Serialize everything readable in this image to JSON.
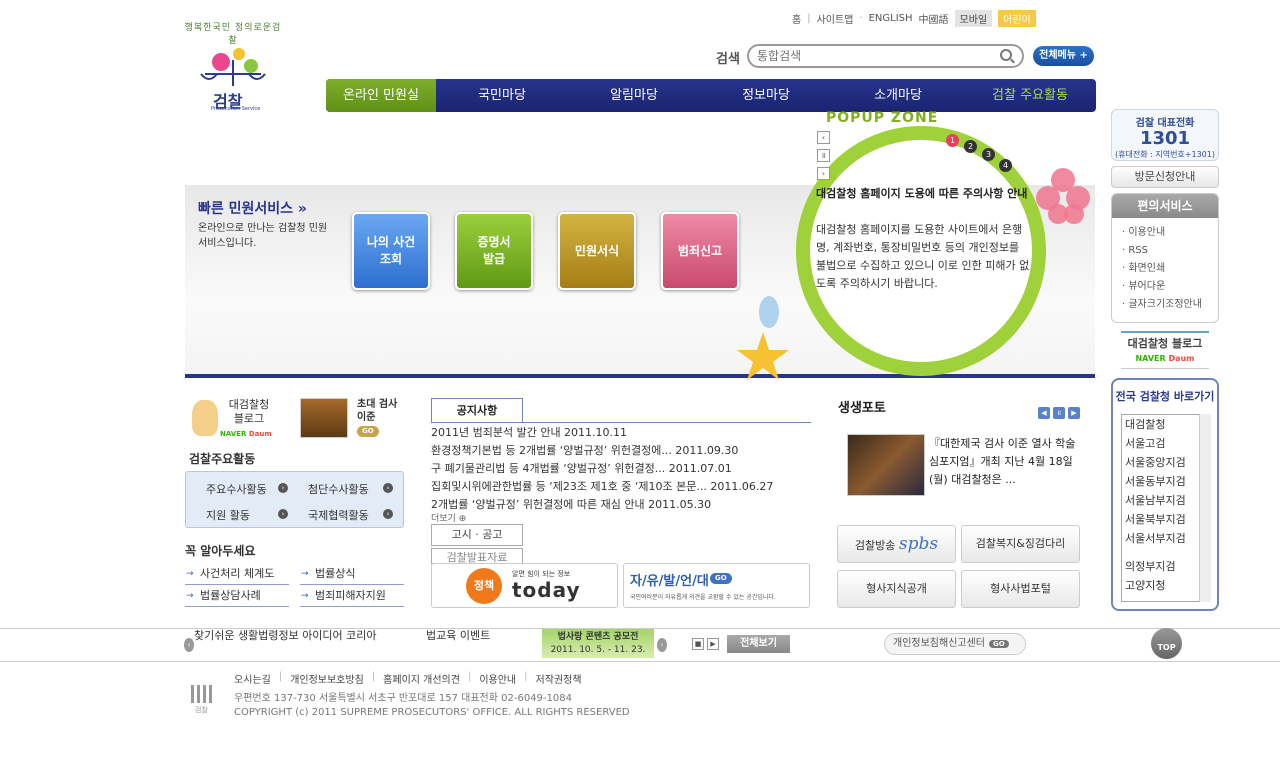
{
  "util": {
    "home": "홈",
    "sitemap": "사이트맵",
    "english": "ENGLISH",
    "chinese": "中國語",
    "mobile": "모바일",
    "kids": "어린이"
  },
  "logo": {
    "arc": "행복한국민 정의로운검찰",
    "name": "검찰",
    "sub": "Prosecution Service"
  },
  "search": {
    "label": "검색",
    "placeholder": "통합검색",
    "full_menu": "전체메뉴"
  },
  "gnb": [
    "온라인 민원실",
    "국민마당",
    "알림마당",
    "정보마당",
    "소개마당",
    "검찰 주요활동"
  ],
  "rep_phone": {
    "title": "검찰 대표전화",
    "number": "1301",
    "note": "(휴대전화 : 지역번호+1301)"
  },
  "visit": "방문신청안내",
  "convenience": {
    "title": "편의서비스",
    "items": [
      "이용안내",
      "RSS",
      "화면인쇄",
      "뷰어다운",
      "글자크기조정안내"
    ]
  },
  "blog_right": {
    "title": "대검찰청 블로그",
    "naver": "NAVER",
    "daum": "Daum"
  },
  "shortcut": {
    "title": "전국 검찰청 바로가기",
    "items": [
      "대검찰청",
      "서울고검",
      "서울중앙지검",
      "서울동부지검",
      "서울남부지검",
      "서울북부지검",
      "서울서부지검",
      "",
      "의정부지검",
      "고양지청"
    ]
  },
  "quick": {
    "title": "빠른 민원서비스",
    "desc": "온라인으로 만나는 검찰청 민원 서비스입니다.",
    "buttons": [
      "나의 사건 조회",
      "증명서 발급",
      "민원서식",
      "범죄신고"
    ]
  },
  "popup": {
    "title": "POPUP ZONE",
    "pages": [
      "1",
      "2",
      "3",
      "4"
    ],
    "head": "대검찰청 홈페이지 도용에 따른 주의사항 안내",
    "body": "대검찰청 홈페이지를 도용한 사이트에서 은행명, 계좌번호, 통장비밀번호 등의 개인정보를 불법으로 수집하고 있으니 이로 인한 피해가 없도록 주의하시기 바랍니다."
  },
  "left": {
    "blog": "대검찰청 블로그",
    "prosecutor": "초대 검사 이준",
    "go": "GO",
    "activities_title": "검찰주요활동",
    "activities": [
      "주요수사활동",
      "첨단수사활동",
      "지원 활동",
      "국제협력활동"
    ],
    "know_title": "꼭 알아두세요",
    "know": [
      "사건처리 체계도",
      "법률상식",
      "법률상담사례",
      "범죄피해자지원"
    ]
  },
  "notice": {
    "tab": "공지사항",
    "items": [
      "2011년 범죄분석 발간 안내 2011.10.11",
      "환경정책기본법 등 2개법률 ‘양벌규정’ 위헌결정에... 2011.09.30",
      "구 폐기물관리법 등 4개법률 ‘양벌규정’ 위헌결정... 2011.07.01",
      "집회및시위에관한법률 등 ‘제23조 제1호 중 ‘제10조 본문... 2011.06.27",
      "2개법률 ‘양벌규정’ 위헌결정에 따른 재심 안내 2011.05.30"
    ],
    "more": "더보기",
    "tab2": "고시 · 공고",
    "tab3": "검찰발표자료"
  },
  "banners": {
    "jung": "정책",
    "jung_small": "알면 힘이 되는 정보",
    "jung_big": "today",
    "free": "자/유/발/언/대",
    "free_go": "GO",
    "free_small": "국민여러분이 자유롭게 의견을 교환할 수 있는 공간입니다."
  },
  "photo": {
    "title": "생생포토",
    "caption": "『대한제국 검사 이준 열사 학술심포지엄』개최 지난 4월 18일(월) 대검찰청은 ..."
  },
  "services": [
    "검찰방송",
    "spbs",
    "검찰복지&징검다리",
    "형사지식공개",
    "형사사법포털"
  ],
  "ticker": {
    "item1": "찾기쉬운 생활법령정보 아이디어 코리아",
    "item2": "법교육 이벤트",
    "law_banner": "법사랑 콘텐츠 공모전",
    "law_dates": "2011. 10. 5. - 11. 23.",
    "view_all": "전체보기",
    "privacy": "개인정보침해신고센터",
    "privacy_go": "GO",
    "top": "TOP"
  },
  "footer": {
    "links": [
      "오시는길",
      "개인정보보호방침",
      "홈페이지 개선의견",
      "이용안내",
      "저작권정책"
    ],
    "address": "우편번호 137-730 서울특별시 서초구 반포대로 157 대표전화 02-6049-1084",
    "copyright": "COPYRIGHT (c) 2011 SUPREME PROSECUTORS' OFFICE. ALL RIGHTS RESERVED",
    "logo": "검찰"
  },
  "colors": {
    "navy": "#27348b",
    "green": "#7fae2a",
    "ring": "#9fd13a"
  }
}
